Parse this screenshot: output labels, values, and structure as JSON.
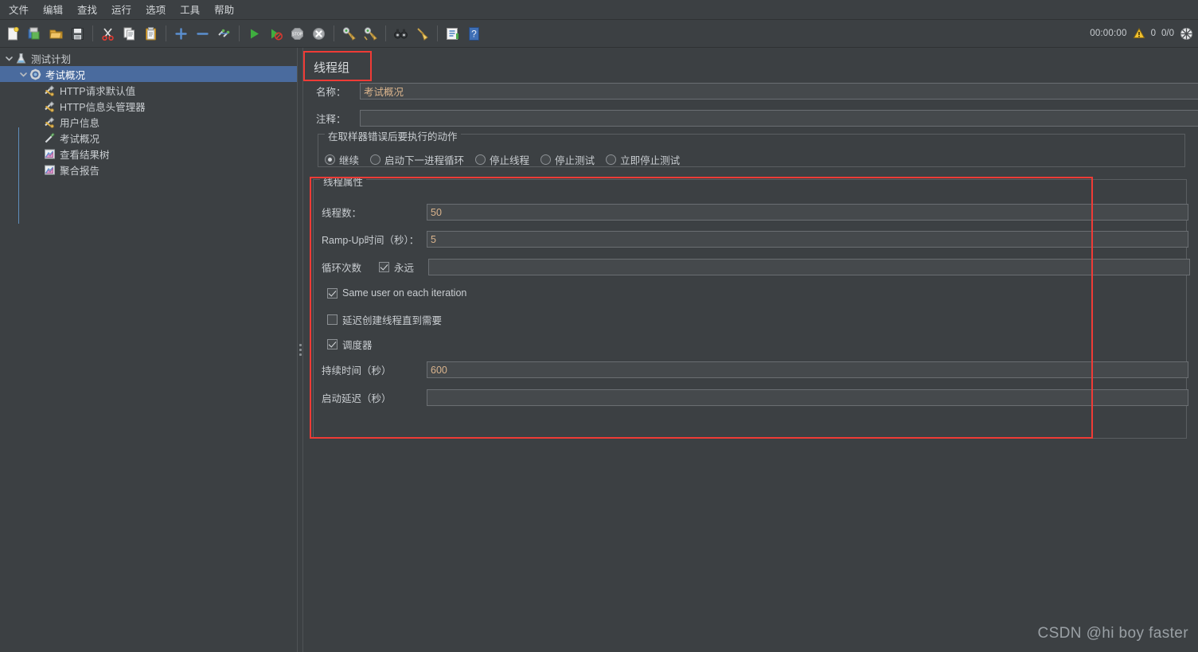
{
  "menubar": {
    "items": [
      {
        "label": "文件",
        "name": "menu-file"
      },
      {
        "label": "编辑",
        "name": "menu-edit"
      },
      {
        "label": "查找",
        "name": "menu-search"
      },
      {
        "label": "运行",
        "name": "menu-run"
      },
      {
        "label": "选项",
        "name": "menu-options"
      },
      {
        "label": "工具",
        "name": "menu-tools"
      },
      {
        "label": "帮助",
        "name": "menu-help"
      }
    ]
  },
  "toolbar": {
    "icons": [
      {
        "name": "new-icon"
      },
      {
        "name": "templates-icon"
      },
      {
        "name": "open-icon"
      },
      {
        "name": "save-icon"
      },
      {
        "name": "cut-icon"
      },
      {
        "name": "copy-icon"
      },
      {
        "name": "paste-icon"
      },
      {
        "name": "expand-icon"
      },
      {
        "name": "collapse-icon"
      },
      {
        "name": "toggle-icon"
      },
      {
        "name": "start-icon"
      },
      {
        "name": "start-no-pauses-icon"
      },
      {
        "name": "stop-icon"
      },
      {
        "name": "shutdown-icon"
      },
      {
        "name": "clear-icon"
      },
      {
        "name": "clear-all-icon"
      },
      {
        "name": "search-icon"
      },
      {
        "name": "reset-search-icon"
      },
      {
        "name": "function-helper-icon"
      },
      {
        "name": "help-icon"
      }
    ],
    "status": {
      "timer": "00:00:00",
      "warning_icon": "warning-icon",
      "warning_count": "0",
      "thread_counts": "0/0",
      "activity_icon": "activity-indicator"
    }
  },
  "tree": {
    "nodes": [
      {
        "label": "测试计划",
        "icon": "test-plan-icon",
        "depth": 0,
        "twisty": "expanded",
        "selected": false
      },
      {
        "label": "考试概况",
        "icon": "thread-group-icon",
        "depth": 1,
        "twisty": "expanded",
        "selected": true
      },
      {
        "label": "HTTP请求默认值",
        "icon": "config-element-icon",
        "depth": 2,
        "twisty": "none",
        "selected": false
      },
      {
        "label": "HTTP信息头管理器",
        "icon": "config-element-icon",
        "depth": 2,
        "twisty": "none",
        "selected": false
      },
      {
        "label": "用户信息",
        "icon": "config-element-icon",
        "depth": 2,
        "twisty": "none",
        "selected": false
      },
      {
        "label": "考试概况",
        "icon": "http-sampler-icon",
        "depth": 2,
        "twisty": "none",
        "selected": false
      },
      {
        "label": "查看结果树",
        "icon": "listener-icon",
        "depth": 2,
        "twisty": "none",
        "selected": false
      },
      {
        "label": "聚合报告",
        "icon": "listener-icon",
        "depth": 2,
        "twisty": "none",
        "selected": false
      }
    ]
  },
  "detail": {
    "title": "线程组",
    "name_label": "名称：",
    "name_value": "考试概况",
    "comment_label": "注释：",
    "comment_value": "",
    "action_group": {
      "title": "在取样器错误后要执行的动作",
      "options": [
        {
          "label": "继续",
          "selected": true
        },
        {
          "label": "启动下一进程循环",
          "selected": false
        },
        {
          "label": "停止线程",
          "selected": false
        },
        {
          "label": "停止测试",
          "selected": false
        },
        {
          "label": "立即停止测试",
          "selected": false
        }
      ]
    },
    "thread_properties": {
      "title": "线程属性",
      "threads_label": "线程数：",
      "threads_value": "50",
      "rampup_label": "Ramp-Up时间（秒）：",
      "rampup_value": "5",
      "loops_label": "循环次数",
      "forever_label": "永远",
      "forever_checked": true,
      "loops_value": "",
      "same_user_label": "Same user on each iteration",
      "same_user_checked": true,
      "delay_create_label": "延迟创建线程直到需要",
      "delay_create_checked": false,
      "scheduler_label": "调度器",
      "scheduler_checked": true,
      "duration_label": "持续时间（秒）",
      "duration_value": "600",
      "startup_delay_label": "启动延迟（秒）",
      "startup_delay_value": ""
    }
  },
  "watermark": "CSDN @hi boy faster",
  "colors": {
    "background": "#3c4043",
    "selection": "#4a6b9e",
    "annotation": "#ef3b36",
    "field_text": "#d9b38c",
    "text": "#c9cdd1"
  }
}
